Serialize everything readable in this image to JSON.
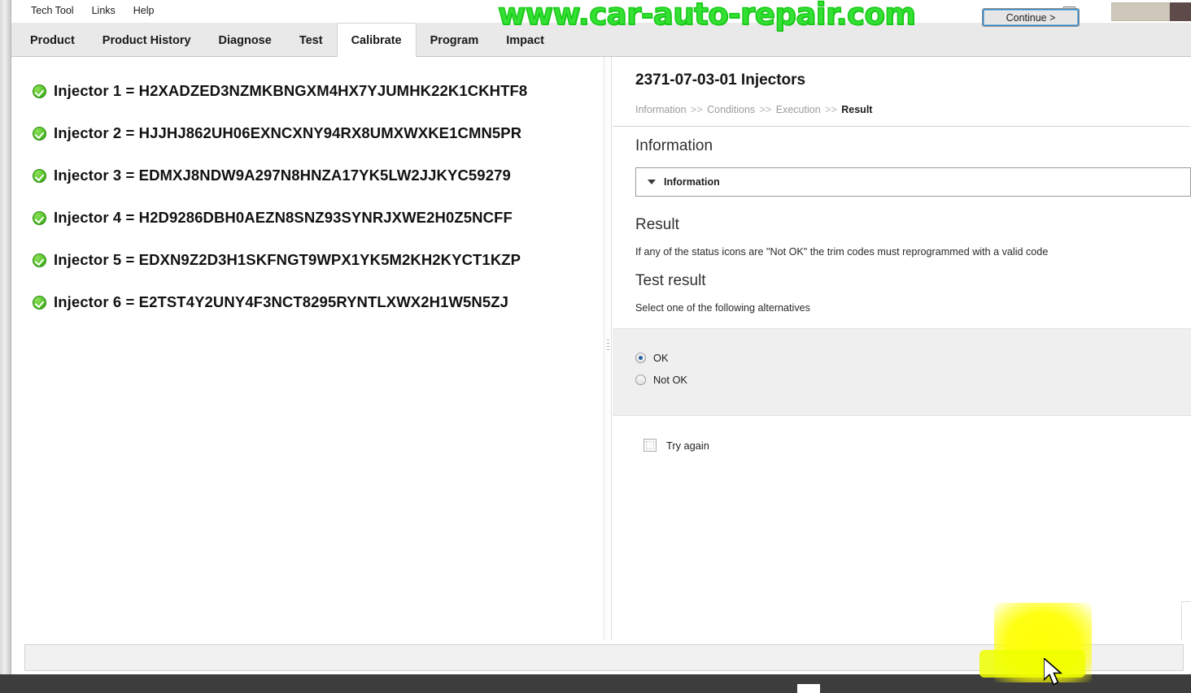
{
  "window": {
    "menu_items": [
      "Tech Tool",
      "Links",
      "Help"
    ],
    "watermark": "www.car-auto-repair.com",
    "notification_icon": "document-alert-icon"
  },
  "tabs": [
    {
      "label": "Product",
      "active": false
    },
    {
      "label": "Product History",
      "active": false
    },
    {
      "label": "Diagnose",
      "active": false
    },
    {
      "label": "Test",
      "active": false
    },
    {
      "label": "Calibrate",
      "active": true
    },
    {
      "label": "Program",
      "active": false
    },
    {
      "label": "Impact",
      "active": false
    }
  ],
  "left_pane": {
    "injectors": [
      {
        "status": "ok",
        "label": "Injector 1 = H2XADZED3NZMKBNGXM4HX7YJUMHK22K1CKHTF8"
      },
      {
        "status": "ok",
        "label": "Injector 2 = HJJHJ862UH06EXNCXNY94RX8UMXWXKE1CMN5PR"
      },
      {
        "status": "ok",
        "label": "Injector 3 = EDMXJ8NDW9A297N8HNZA17YK5LW2JJKYC59279"
      },
      {
        "status": "ok",
        "label": "Injector 4 = H2D9286DBH0AEZN8SNZ93SYNRJXWE2H0Z5NCFF"
      },
      {
        "status": "ok",
        "label": "Injector 5 = EDXN9Z2D3H1SKFNGT9WPX1YK5M2KH2KYCT1KZP"
      },
      {
        "status": "ok",
        "label": "Injector 6 = E2TST4Y2UNY4F3NCT8295RYNTLXWX2H1W5N5ZJ"
      }
    ]
  },
  "right_pane": {
    "title": "2371-07-03-01 Injectors",
    "breadcrumb": {
      "steps": [
        "Information",
        "Conditions",
        "Execution"
      ],
      "current": "Result",
      "separator": ">>"
    },
    "information_heading": "Information",
    "information_accordion_label": "Information",
    "result_heading": "Result",
    "result_note": "If any of the status icons are \"Not OK\" the trim codes must reprogrammed with a valid code",
    "test_result_heading": "Test result",
    "select_prompt": "Select one of the following alternatives",
    "alternatives": [
      {
        "label": "OK",
        "selected": true
      },
      {
        "label": "Not OK",
        "selected": false
      }
    ],
    "try_again": {
      "label": "Try again",
      "checked": false
    }
  },
  "footer": {
    "continue_label": "Continue >"
  },
  "colors": {
    "status_ok": "#54c22a",
    "watermark_green": "#33e033",
    "highlight_yellow": "#ffff00",
    "radio_selected": "#2a63a4",
    "focus_ring": "#2f88c9",
    "tab_active_bg": "#ffffff",
    "tabstrip_bg": "#e9e9e9",
    "panel_grey": "#efefef"
  }
}
